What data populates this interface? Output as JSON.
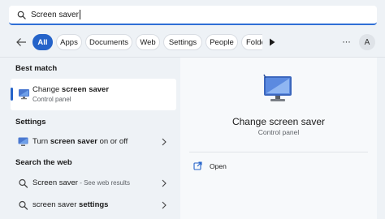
{
  "search": {
    "value": "Screen saver",
    "icon": "search-icon"
  },
  "filters": {
    "chips": [
      {
        "label": "All",
        "active": true
      },
      {
        "label": "Apps"
      },
      {
        "label": "Documents"
      },
      {
        "label": "Web"
      },
      {
        "label": "Settings"
      },
      {
        "label": "People"
      },
      {
        "label": "Folde"
      }
    ],
    "avatar_initial": "A",
    "more_label": "···"
  },
  "sections": {
    "best_match": "Best match",
    "settings": "Settings",
    "search_web": "Search the web"
  },
  "best_match": {
    "title_prefix": "Change ",
    "title_bold": "screen saver",
    "subtitle": "Control panel"
  },
  "settings_items": [
    {
      "prefix": "Turn ",
      "bold": "screen saver",
      "suffix": " on or off"
    }
  ],
  "web_items": [
    {
      "prefix": "Screen saver",
      "bold": "",
      "hint": " - See web results"
    },
    {
      "prefix": "screen saver ",
      "bold": "settings",
      "hint": ""
    }
  ],
  "preview": {
    "title": "Change screen saver",
    "subtitle": "Control panel",
    "action_label": "Open"
  },
  "colors": {
    "accent": "#2563c9"
  }
}
